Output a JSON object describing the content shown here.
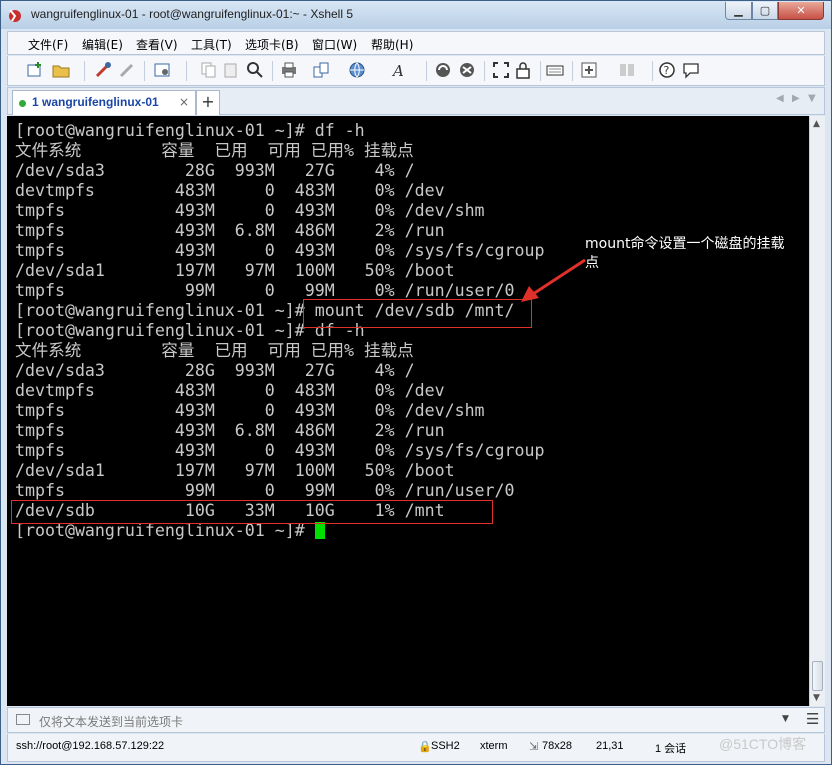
{
  "window": {
    "title": "wangruifenglinux-01 - root@wangruifenglinux-01:~ - Xshell 5",
    "controls": {
      "minimize": "▁",
      "maximize": "▢",
      "close": "✕"
    }
  },
  "menu": [
    "文件(F)",
    "编辑(E)",
    "查看(V)",
    "工具(T)",
    "选项卡(B)",
    "窗口(W)",
    "帮助(H)"
  ],
  "tabs": [
    {
      "label": "1 wangruifenglinux-01",
      "close": "×",
      "status_color": "#2eaa3a"
    }
  ],
  "tab_add": "+",
  "tab_nav": {
    "prev": "◀",
    "next": "▶",
    "menu": "▼"
  },
  "terminal": {
    "lines": [
      "[root@wangruifenglinux-01 ~]# df -h",
      "文件系统        容量  已用  可用 已用% 挂载点",
      "/dev/sda3        28G  993M   27G    4% /",
      "devtmpfs        483M     0  483M    0% /dev",
      "tmpfs           493M     0  493M    0% /dev/shm",
      "tmpfs           493M  6.8M  486M    2% /run",
      "tmpfs           493M     0  493M    0% /sys/fs/cgroup",
      "/dev/sda1       197M   97M  100M   50% /boot",
      "tmpfs            99M     0   99M    0% /run/user/0",
      "[root@wangruifenglinux-01 ~]# mount /dev/sdb /mnt/",
      "[root@wangruifenglinux-01 ~]# df -h",
      "文件系统        容量  已用  可用 已用% 挂载点",
      "/dev/sda3        28G  993M   27G    4% /",
      "devtmpfs        483M     0  483M    0% /dev",
      "tmpfs           493M     0  493M    0% /dev/shm",
      "tmpfs           493M  6.8M  486M    2% /run",
      "tmpfs           493M     0  493M    0% /sys/fs/cgroup",
      "/dev/sda1       197M   97M  100M   50% /boot",
      "tmpfs            99M     0   99M    0% /run/user/0",
      "/dev/sdb         10G   33M   10G    1% /mnt",
      "[root@wangruifenglinux-01 ~]# "
    ],
    "text_color": "#c8c8c8",
    "cursor_color": "#00e000",
    "annotation": "mount命令设置一个磁盘的挂载点",
    "annotation_color": "#e0302a"
  },
  "send_bar": {
    "placeholder": "仅将文本发送到当前选项卡"
  },
  "status": {
    "connection": "ssh://root@192.168.57.129:22",
    "protocol": "SSH2",
    "term_type": "xterm",
    "size": "78x28",
    "position": "21,31",
    "sessions": "1 会话"
  },
  "watermark": "@51CTO博客"
}
